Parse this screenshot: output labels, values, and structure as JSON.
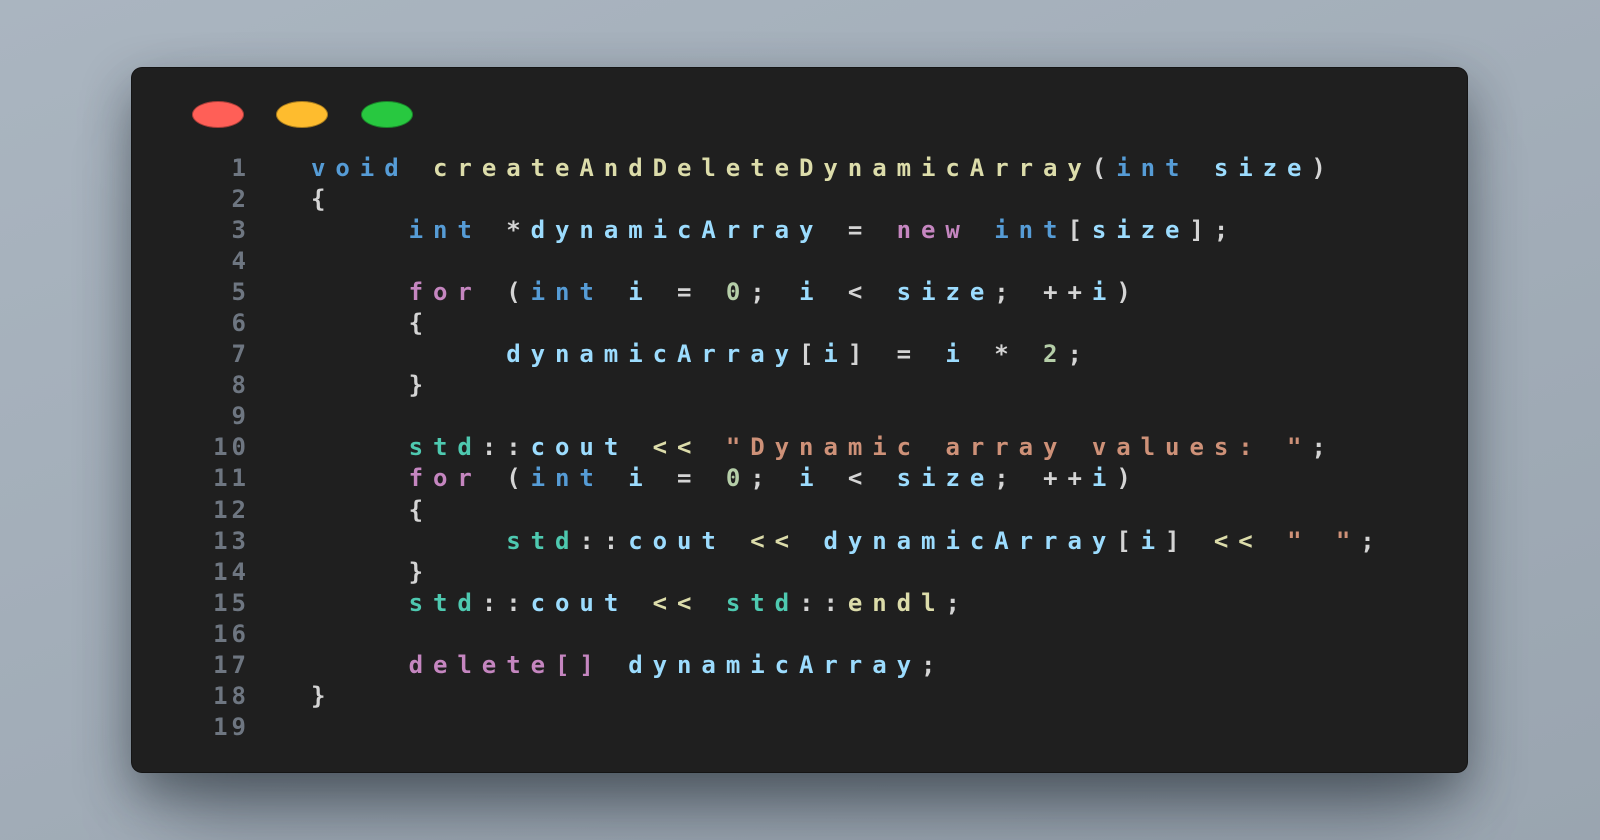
{
  "window": {
    "controls": [
      {
        "name": "close",
        "color": "#ff5f57"
      },
      {
        "name": "minimize",
        "color": "#febc2e"
      },
      {
        "name": "maximize",
        "color": "#28c840"
      }
    ],
    "background_color": "#1f1f1f"
  },
  "code": {
    "language": "cpp",
    "lines": [
      {
        "number": "1",
        "tokens": [
          {
            "t": "void",
            "k": "keyword"
          },
          {
            "t": " ",
            "k": "punct"
          },
          {
            "t": "createAndDeleteDynamicArray",
            "k": "function"
          },
          {
            "t": "(",
            "k": "punct"
          },
          {
            "t": "int",
            "k": "keyword"
          },
          {
            "t": " ",
            "k": "punct"
          },
          {
            "t": "size",
            "k": "variable"
          },
          {
            "t": ")",
            "k": "punct"
          }
        ]
      },
      {
        "number": "2",
        "tokens": [
          {
            "t": "{",
            "k": "punct"
          }
        ]
      },
      {
        "number": "3",
        "tokens": [
          {
            "t": "    ",
            "k": "punct"
          },
          {
            "t": "int",
            "k": "keyword"
          },
          {
            "t": " ",
            "k": "punct"
          },
          {
            "t": "*",
            "k": "operator"
          },
          {
            "t": "dynamicArray",
            "k": "variable"
          },
          {
            "t": " = ",
            "k": "operator"
          },
          {
            "t": "new",
            "k": "control"
          },
          {
            "t": " ",
            "k": "punct"
          },
          {
            "t": "int",
            "k": "keyword"
          },
          {
            "t": "[",
            "k": "punct"
          },
          {
            "t": "size",
            "k": "variable"
          },
          {
            "t": "];",
            "k": "punct"
          }
        ]
      },
      {
        "number": "4",
        "tokens": []
      },
      {
        "number": "5",
        "tokens": [
          {
            "t": "    ",
            "k": "punct"
          },
          {
            "t": "for",
            "k": "control"
          },
          {
            "t": " (",
            "k": "punct"
          },
          {
            "t": "int",
            "k": "keyword"
          },
          {
            "t": " ",
            "k": "punct"
          },
          {
            "t": "i",
            "k": "variable"
          },
          {
            "t": " = ",
            "k": "operator"
          },
          {
            "t": "0",
            "k": "number"
          },
          {
            "t": "; ",
            "k": "punct"
          },
          {
            "t": "i",
            "k": "variable"
          },
          {
            "t": " < ",
            "k": "operator"
          },
          {
            "t": "size",
            "k": "variable"
          },
          {
            "t": "; ",
            "k": "punct"
          },
          {
            "t": "++",
            "k": "operator"
          },
          {
            "t": "i",
            "k": "variable"
          },
          {
            "t": ")",
            "k": "punct"
          }
        ]
      },
      {
        "number": "6",
        "tokens": [
          {
            "t": "    {",
            "k": "punct"
          }
        ]
      },
      {
        "number": "7",
        "tokens": [
          {
            "t": "        ",
            "k": "punct"
          },
          {
            "t": "dynamicArray",
            "k": "variable"
          },
          {
            "t": "[",
            "k": "punct"
          },
          {
            "t": "i",
            "k": "variable"
          },
          {
            "t": "]",
            "k": "punct"
          },
          {
            "t": " = ",
            "k": "operator"
          },
          {
            "t": "i",
            "k": "variable"
          },
          {
            "t": " * ",
            "k": "operator"
          },
          {
            "t": "2",
            "k": "number"
          },
          {
            "t": ";",
            "k": "punct"
          }
        ]
      },
      {
        "number": "8",
        "tokens": [
          {
            "t": "    }",
            "k": "punct"
          }
        ]
      },
      {
        "number": "9",
        "tokens": []
      },
      {
        "number": "10",
        "tokens": [
          {
            "t": "    ",
            "k": "punct"
          },
          {
            "t": "std",
            "k": "namespace"
          },
          {
            "t": "::",
            "k": "punct"
          },
          {
            "t": "cout",
            "k": "variable"
          },
          {
            "t": " ",
            "k": "punct"
          },
          {
            "t": "<<",
            "k": "opfn"
          },
          {
            "t": " ",
            "k": "punct"
          },
          {
            "t": "\"Dynamic array values: \"",
            "k": "string"
          },
          {
            "t": ";",
            "k": "punct"
          }
        ]
      },
      {
        "number": "11",
        "tokens": [
          {
            "t": "    ",
            "k": "punct"
          },
          {
            "t": "for",
            "k": "control"
          },
          {
            "t": " (",
            "k": "punct"
          },
          {
            "t": "int",
            "k": "keyword"
          },
          {
            "t": " ",
            "k": "punct"
          },
          {
            "t": "i",
            "k": "variable"
          },
          {
            "t": " = ",
            "k": "operator"
          },
          {
            "t": "0",
            "k": "number"
          },
          {
            "t": "; ",
            "k": "punct"
          },
          {
            "t": "i",
            "k": "variable"
          },
          {
            "t": " < ",
            "k": "operator"
          },
          {
            "t": "size",
            "k": "variable"
          },
          {
            "t": "; ",
            "k": "punct"
          },
          {
            "t": "++",
            "k": "operator"
          },
          {
            "t": "i",
            "k": "variable"
          },
          {
            "t": ")",
            "k": "punct"
          }
        ]
      },
      {
        "number": "12",
        "tokens": [
          {
            "t": "    {",
            "k": "punct"
          }
        ]
      },
      {
        "number": "13",
        "tokens": [
          {
            "t": "        ",
            "k": "punct"
          },
          {
            "t": "std",
            "k": "namespace"
          },
          {
            "t": "::",
            "k": "punct"
          },
          {
            "t": "cout",
            "k": "variable"
          },
          {
            "t": " ",
            "k": "punct"
          },
          {
            "t": "<<",
            "k": "opfn"
          },
          {
            "t": " ",
            "k": "punct"
          },
          {
            "t": "dynamicArray",
            "k": "variable"
          },
          {
            "t": "[",
            "k": "punct"
          },
          {
            "t": "i",
            "k": "variable"
          },
          {
            "t": "]",
            "k": "punct"
          },
          {
            "t": " ",
            "k": "punct"
          },
          {
            "t": "<<",
            "k": "opfn"
          },
          {
            "t": " ",
            "k": "punct"
          },
          {
            "t": "\" \"",
            "k": "string"
          },
          {
            "t": ";",
            "k": "punct"
          }
        ]
      },
      {
        "number": "14",
        "tokens": [
          {
            "t": "    }",
            "k": "punct"
          }
        ]
      },
      {
        "number": "15",
        "tokens": [
          {
            "t": "    ",
            "k": "punct"
          },
          {
            "t": "std",
            "k": "namespace"
          },
          {
            "t": "::",
            "k": "punct"
          },
          {
            "t": "cout",
            "k": "variable"
          },
          {
            "t": " ",
            "k": "punct"
          },
          {
            "t": "<<",
            "k": "opfn"
          },
          {
            "t": " ",
            "k": "punct"
          },
          {
            "t": "std",
            "k": "namespace"
          },
          {
            "t": "::",
            "k": "punct"
          },
          {
            "t": "endl",
            "k": "function"
          },
          {
            "t": ";",
            "k": "punct"
          }
        ]
      },
      {
        "number": "16",
        "tokens": []
      },
      {
        "number": "17",
        "tokens": [
          {
            "t": "    ",
            "k": "punct"
          },
          {
            "t": "delete[]",
            "k": "control"
          },
          {
            "t": " ",
            "k": "punct"
          },
          {
            "t": "dynamicArray",
            "k": "variable"
          },
          {
            "t": ";",
            "k": "punct"
          }
        ]
      },
      {
        "number": "18",
        "tokens": [
          {
            "t": "}",
            "k": "punct"
          }
        ]
      },
      {
        "number": "19",
        "tokens": []
      }
    ]
  }
}
